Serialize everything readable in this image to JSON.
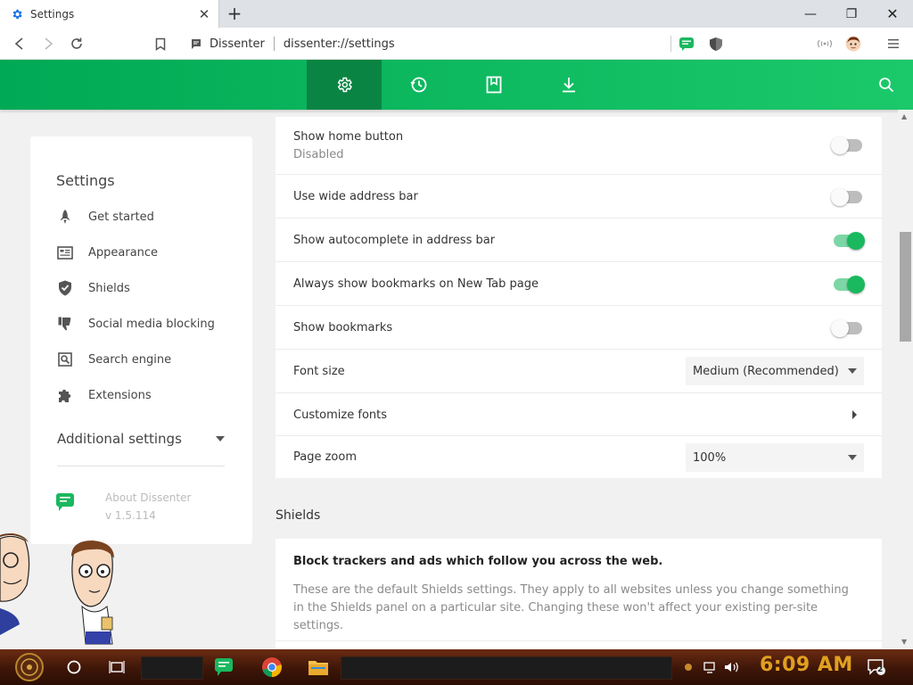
{
  "browser": {
    "tab_title": "Settings",
    "tab_close": "✕",
    "new_tab": "+",
    "window_controls": {
      "minimize": "—",
      "maximize": "❐",
      "close": "✕"
    },
    "site_name": "Dissenter",
    "url": "dissenter://settings"
  },
  "header": {
    "nav": [
      {
        "icon": "gear-icon",
        "active": true
      },
      {
        "icon": "history-icon",
        "active": false
      },
      {
        "icon": "bookmarks-icon",
        "active": false
      },
      {
        "icon": "download-icon",
        "active": false
      }
    ],
    "search_icon": "search-icon"
  },
  "sidebar": {
    "title": "Settings",
    "items": [
      {
        "label": "Get started",
        "icon": "rocket-icon"
      },
      {
        "label": "Appearance",
        "icon": "appearance-icon"
      },
      {
        "label": "Shields",
        "icon": "shield-icon"
      },
      {
        "label": "Social media blocking",
        "icon": "thumbs-down-icon"
      },
      {
        "label": "Search engine",
        "icon": "search-engine-icon"
      },
      {
        "label": "Extensions",
        "icon": "puzzle-icon"
      }
    ],
    "additional": "Additional settings",
    "about": {
      "title": "About Dissenter",
      "version": "v 1.5.114"
    }
  },
  "appearance": {
    "rows": [
      {
        "label": "Show home button",
        "sub": "Disabled",
        "type": "toggle",
        "on": false
      },
      {
        "label": "Use wide address bar",
        "type": "toggle",
        "on": false
      },
      {
        "label": "Show autocomplete in address bar",
        "type": "toggle",
        "on": true
      },
      {
        "label": "Always show bookmarks on New Tab page",
        "type": "toggle",
        "on": true
      },
      {
        "label": "Show bookmarks",
        "type": "toggle",
        "on": false
      },
      {
        "label": "Font size",
        "type": "select",
        "value": "Medium (Recommended)"
      },
      {
        "label": "Customize fonts",
        "type": "link"
      },
      {
        "label": "Page zoom",
        "type": "select",
        "value": "100%"
      }
    ]
  },
  "shields": {
    "section_title": "Shields",
    "heading": "Block trackers and ads which follow you across the web.",
    "description": "These are the default Shields settings. They apply to all websites unless you change something in the Shields panel on a particular site. Changing these won't affect your existing per-site settings."
  },
  "taskbar": {
    "clock": "6:09 AM",
    "notifications": "2"
  },
  "colors": {
    "accent": "#1bc96a",
    "accent_dark": "#0a8443",
    "toggle_on": "#1ab85f",
    "clock": "#e0a020"
  }
}
